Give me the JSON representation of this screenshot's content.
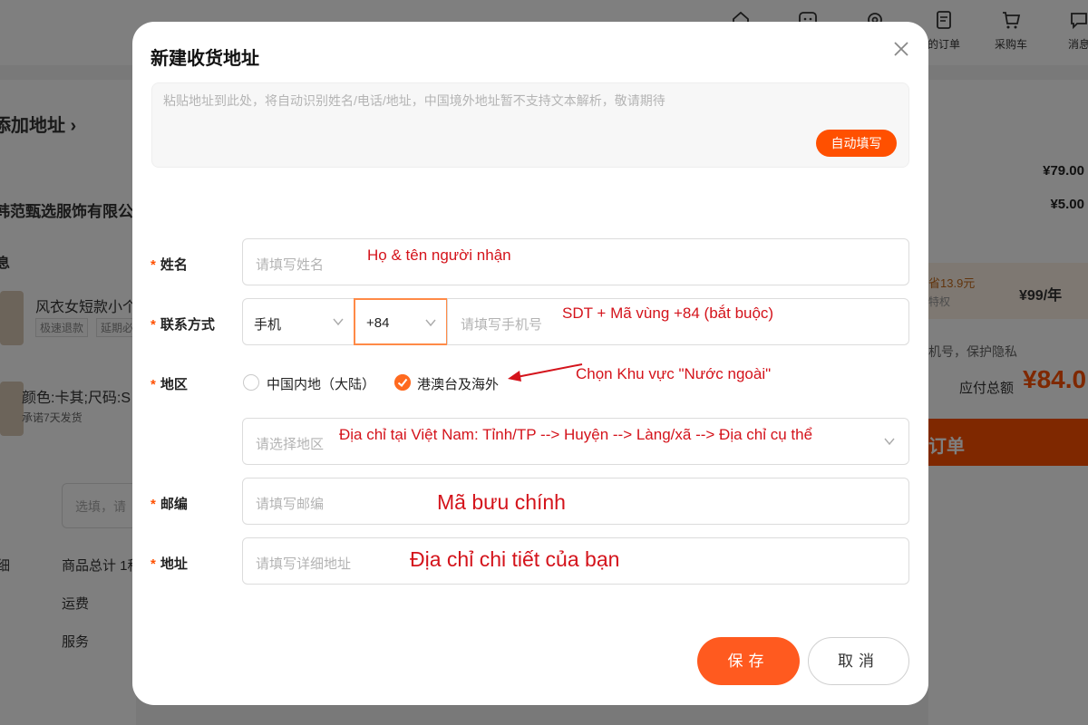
{
  "background": {
    "nav": [
      {
        "label": "",
        "icon": "home-icon"
      },
      {
        "label": "",
        "icon": "chat-icon"
      },
      {
        "label": "",
        "icon": "gear-icon"
      },
      {
        "label": "的订单",
        "icon": "orders-icon"
      },
      {
        "label": "采购车",
        "icon": "cart-icon"
      },
      {
        "label": "消息",
        "icon": "message-icon"
      }
    ],
    "add_address_link": "添加地址 ›",
    "shop_name": "韩范甄选服饰有限公",
    "info_label": "息",
    "product_title": "风衣女短款小个",
    "tags": [
      "极速退款",
      "延期必"
    ],
    "variant": "颜色:卡其;尺码:S",
    "shipping_promise": "承诺7天发货",
    "filter_placeholder": "选填，请",
    "detail_label": "细",
    "summary": [
      "商品总计 1种",
      "运费",
      "服务"
    ],
    "prices": [
      "¥79.00",
      "¥5.00"
    ],
    "vip": {
      "save_text": "省13.9元",
      "rights": "特权",
      "price": "¥99/年"
    },
    "privacy": "机号，保护隐私",
    "total_label": "应付总额",
    "total_value": "¥84.0",
    "order_button": "订单"
  },
  "modal": {
    "title": "新建收货地址",
    "paste_placeholder": "粘贴地址到此处，将自动识别姓名/电话/地址，中国境外地址暂不支持文本解析，敬请期待",
    "autofill_button": "自动填写",
    "required_marker": "*",
    "fields": {
      "name": {
        "label": "姓名",
        "placeholder": "请填写姓名"
      },
      "contact": {
        "label": "联系方式",
        "type_value": "手机",
        "code_value": "+84",
        "placeholder": "请填写手机号"
      },
      "region": {
        "label": "地区",
        "options": [
          {
            "label": "中国内地（大陆）",
            "selected": false
          },
          {
            "label": "港澳台及海外",
            "selected": true
          }
        ],
        "placeholder": "请选择地区"
      },
      "postcode": {
        "label": "邮编",
        "placeholder": "请填写邮编"
      },
      "address": {
        "label": "地址",
        "placeholder": "请填写详细地址"
      }
    },
    "save_button": "保存",
    "cancel_button": "取消"
  },
  "annotations": {
    "name": "Họ & tên người nhận",
    "phone": "SDT + Mã vùng +84 (bắt buộc)",
    "region": "Chọn Khu vực \"Nước ngoài\"",
    "area": "Địa chỉ tại Việt Nam: Tỉnh/TP --> Huyện --> Làng/xã --> Địa chỉ cụ thể",
    "postcode": "Mã bưu chính",
    "address": "Địa chỉ chi tiết của bạn"
  },
  "colors": {
    "accent": "#ff5000",
    "annotation": "#d4131b"
  }
}
